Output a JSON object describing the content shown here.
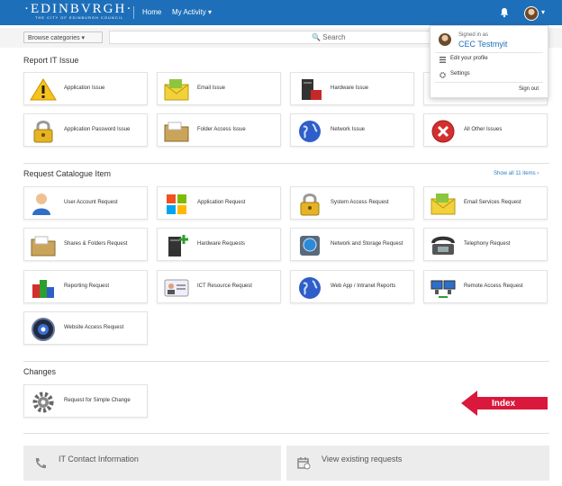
{
  "header": {
    "logo_main": "·EDINBVRGH·",
    "logo_sub": "THE CITY OF EDINBURGH COUNCIL",
    "nav": {
      "home": "Home",
      "my_activity": "My Activity ▾"
    },
    "user_chevron": "▾"
  },
  "search": {
    "browse_label": "Browse categories ▾",
    "placeholder": "🔍 Search"
  },
  "user_menu": {
    "signed_in_as": "Signed in as",
    "name": "CEC Testmyit",
    "edit_profile": "Edit your profile",
    "settings": "Settings",
    "sign_out": "Sign out"
  },
  "report_section": {
    "title": "Report IT Issue",
    "tiles": [
      {
        "label": "Application Issue",
        "icon": "warning-icon"
      },
      {
        "label": "Email Issue",
        "icon": "email-icon"
      },
      {
        "label": "Hardware Issue",
        "icon": "hardware-icon"
      },
      {
        "label": "",
        "icon": ""
      },
      {
        "label": "Application Password Issue",
        "icon": "padlock-icon"
      },
      {
        "label": "Folder Access Issue",
        "icon": "folder-icon"
      },
      {
        "label": "Network Issue",
        "icon": "globe-icon"
      },
      {
        "label": "All Other Issues",
        "icon": "error-icon"
      }
    ]
  },
  "catalogue_section": {
    "title": "Request Catalogue Item",
    "show_all": "Show all 11 items ›",
    "tiles": [
      {
        "label": "User Account Request",
        "icon": "user-icon"
      },
      {
        "label": "Application Request",
        "icon": "windows-icon"
      },
      {
        "label": "System Access Request",
        "icon": "padlock-icon"
      },
      {
        "label": "Email Services Request",
        "icon": "email-icon"
      },
      {
        "label": "Shares & Folders Request",
        "icon": "folder-icon"
      },
      {
        "label": "Hardware Requests",
        "icon": "hardware-add-icon"
      },
      {
        "label": "Network and Storage Request",
        "icon": "storage-icon"
      },
      {
        "label": "Telephony Request",
        "icon": "telephone-icon"
      },
      {
        "label": "Reporting Request",
        "icon": "chart-cubes-icon"
      },
      {
        "label": "ICT Resource Request",
        "icon": "id-card-icon"
      },
      {
        "label": "Web App / Intranet Reports",
        "icon": "globe-icon"
      },
      {
        "label": "Remote Access Request",
        "icon": "remote-computers-icon"
      },
      {
        "label": "Website Access Request",
        "icon": "web-badge-icon"
      }
    ]
  },
  "changes_section": {
    "title": "Changes",
    "tiles": [
      {
        "label": "Request for Simple Change",
        "icon": "gear-icon"
      }
    ]
  },
  "annotation": {
    "label": "Index",
    "color": "#d9183b"
  },
  "bottom": {
    "contact": "IT Contact Information",
    "existing": "View existing requests"
  },
  "colors": {
    "header": "#1e6fb9",
    "link": "#2a7cc7"
  }
}
